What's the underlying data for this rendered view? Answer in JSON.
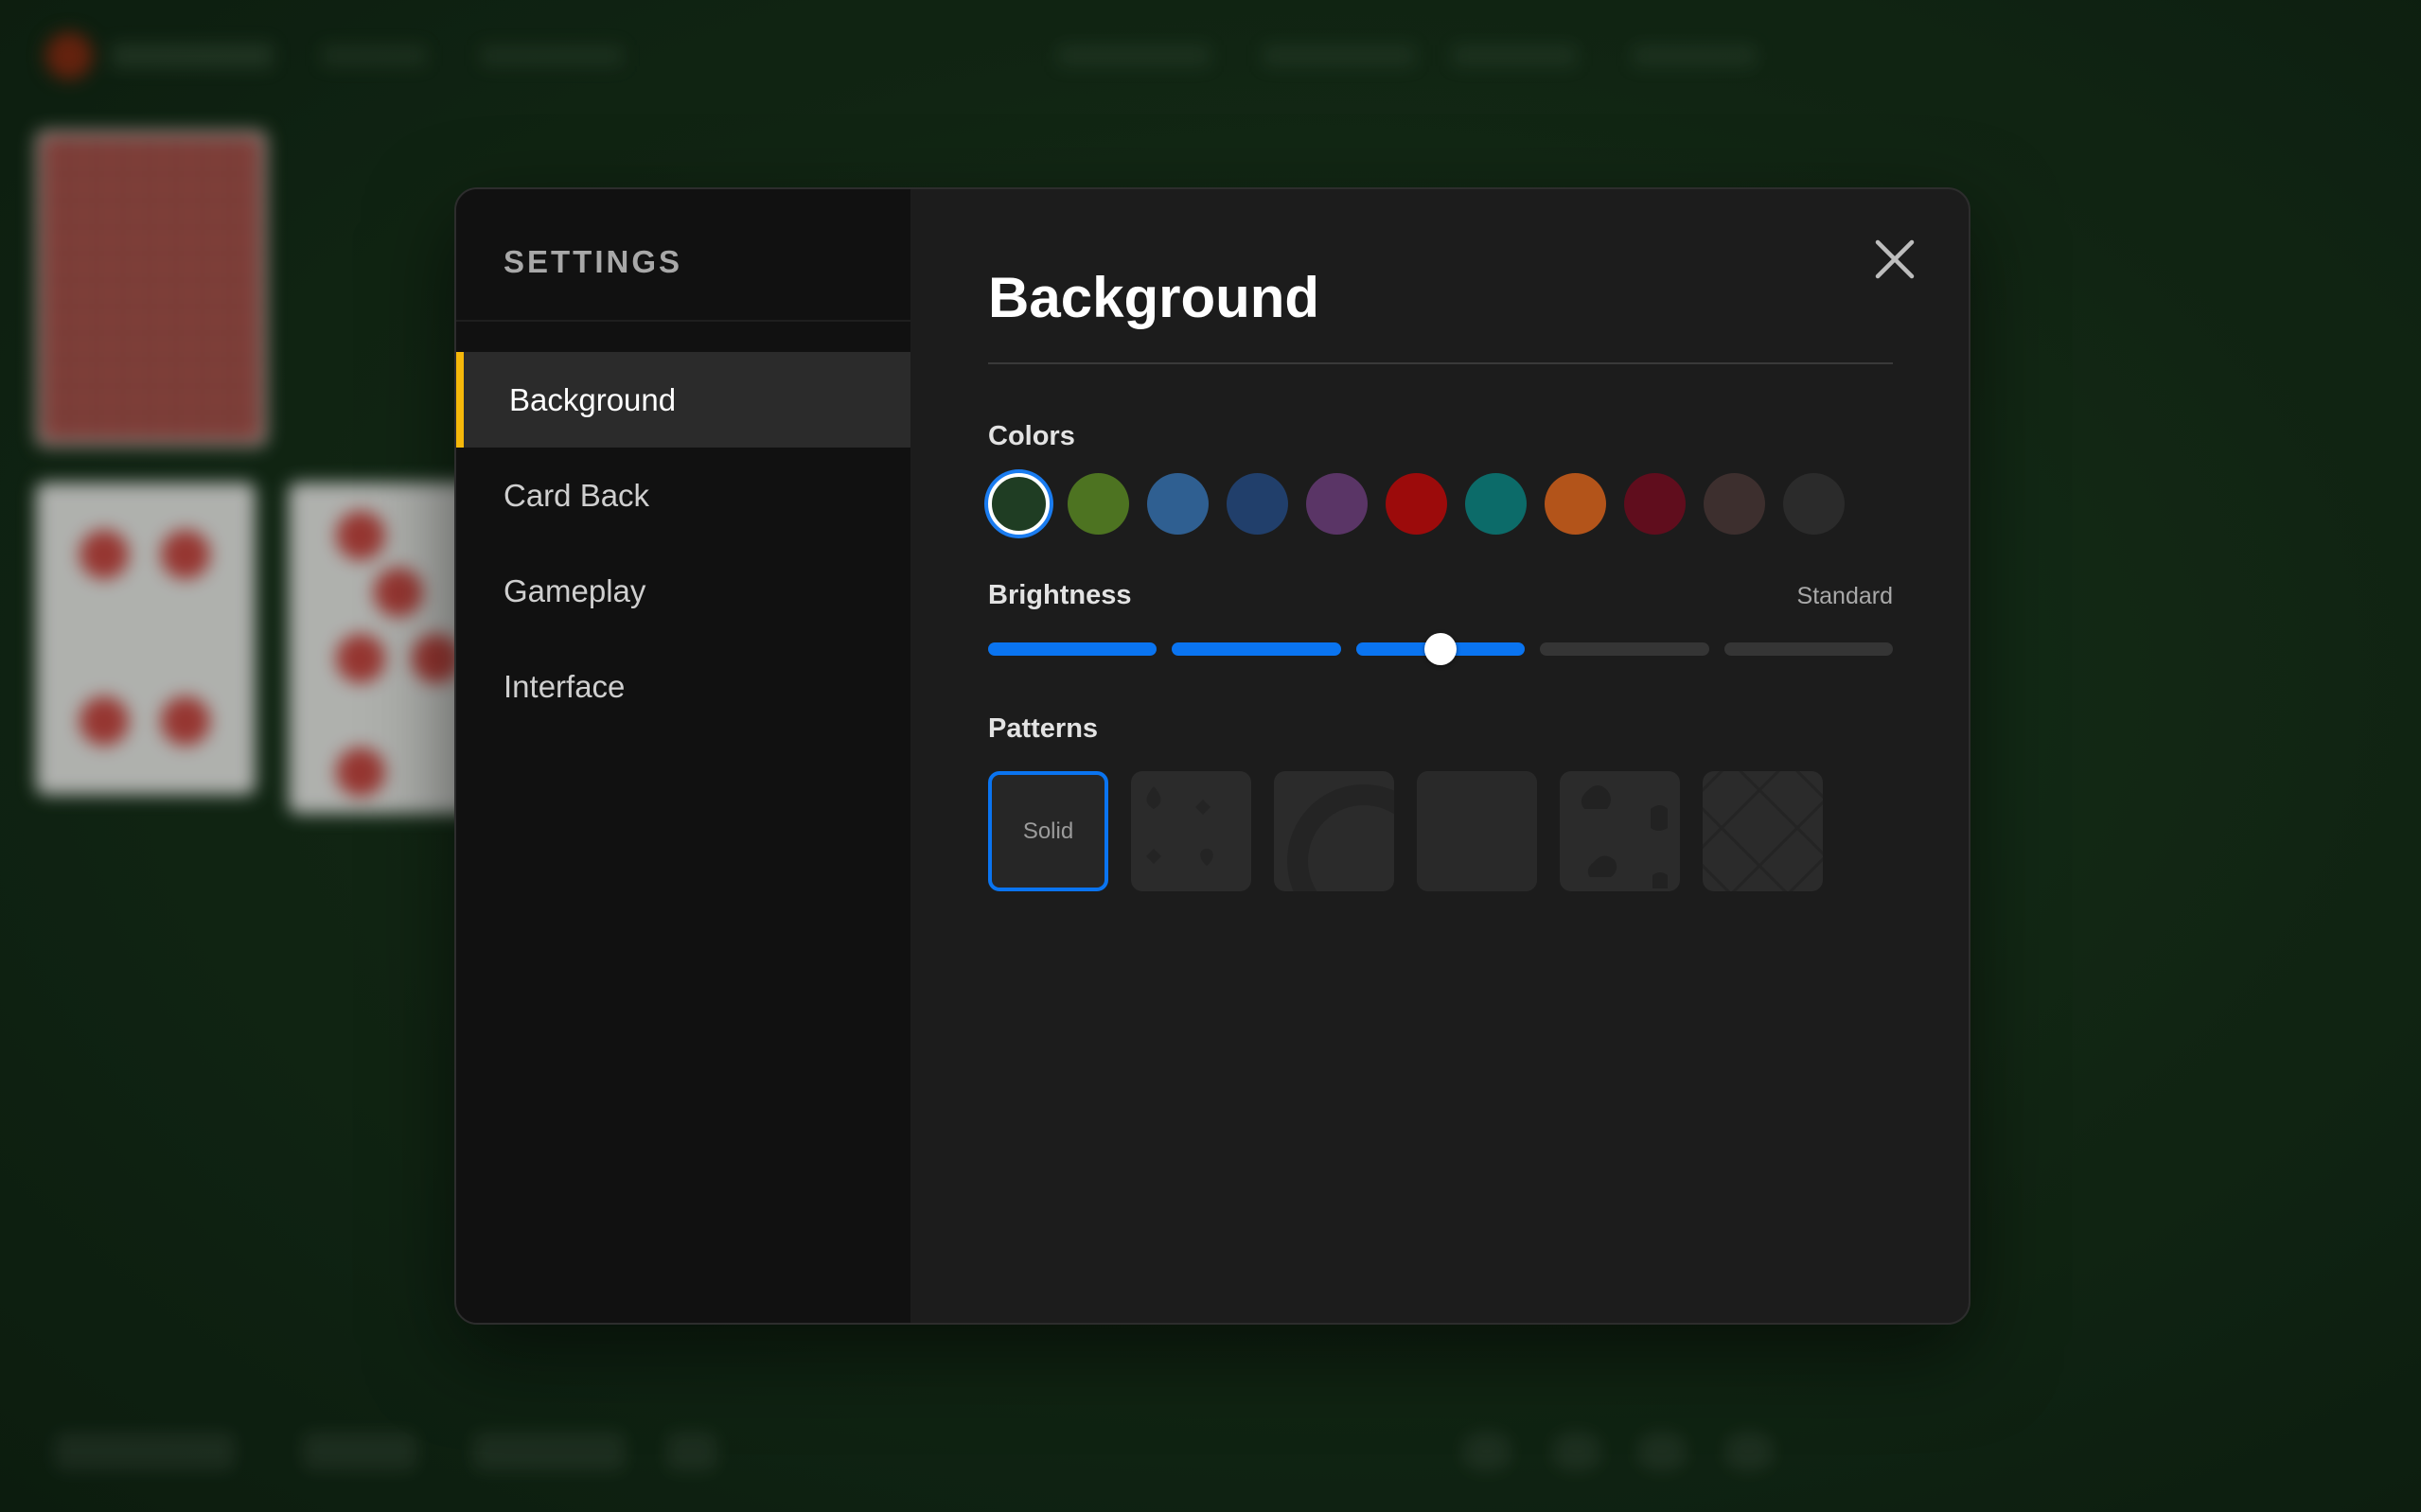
{
  "modal": {
    "sidebar_title": "SETTINGS",
    "nav": [
      {
        "label": "Background",
        "active": true
      },
      {
        "label": "Card Back",
        "active": false
      },
      {
        "label": "Gameplay",
        "active": false
      },
      {
        "label": "Interface",
        "active": false
      }
    ],
    "page_title": "Background",
    "close_icon": "close-icon",
    "colors": {
      "label": "Colors",
      "swatches": [
        "#1f3d23",
        "#4d7321",
        "#2f5f91",
        "#213f6b",
        "#5a3566",
        "#9c0b0b",
        "#0c6b69",
        "#b3541a",
        "#600d1d",
        "#3d2f2e",
        "#2b2b2b"
      ],
      "selected_index": 0
    },
    "brightness": {
      "label": "Brightness",
      "value_label": "Standard",
      "segments": 5,
      "level": 0.5
    },
    "patterns": {
      "label": "Patterns",
      "items": [
        {
          "label": "Solid",
          "selected": true
        },
        {
          "label": "",
          "icon": "suits-pattern-icon"
        },
        {
          "label": "",
          "icon": "circle-pattern-icon"
        },
        {
          "label": "",
          "icon": "texture-pattern-icon"
        },
        {
          "label": "",
          "icon": "waves-pattern-icon"
        },
        {
          "label": "",
          "icon": "diamond-grid-pattern-icon"
        }
      ]
    }
  },
  "accent_colors": {
    "selection_blue": "#0a74f0",
    "active_nav_marker": "#f5b80a"
  }
}
